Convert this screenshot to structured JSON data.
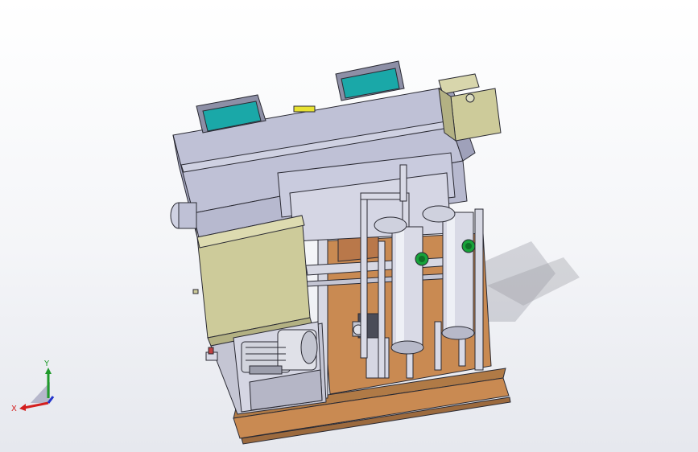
{
  "viewport": {
    "background": "gradient-white-to-light-gray",
    "model": "skid-mounted-water-treatment-unit",
    "colors": {
      "housing": "#c6c8dc",
      "housing_shade": "#a9abc4",
      "screen": "#1aa8a8",
      "panel": "#cdcb9a",
      "deck": "#c98a52",
      "vessel": "#d9dae6",
      "gauge": "#17a23a",
      "motor": "#d2d4dd",
      "outline": "#2a2a33",
      "accent_yellow": "#e8e232"
    }
  },
  "axis_triad": {
    "x_label": "X",
    "y_label": "Y",
    "colors": {
      "x": "#d41f1f",
      "y": "#1f9a2a",
      "z": "#2233cc"
    }
  }
}
